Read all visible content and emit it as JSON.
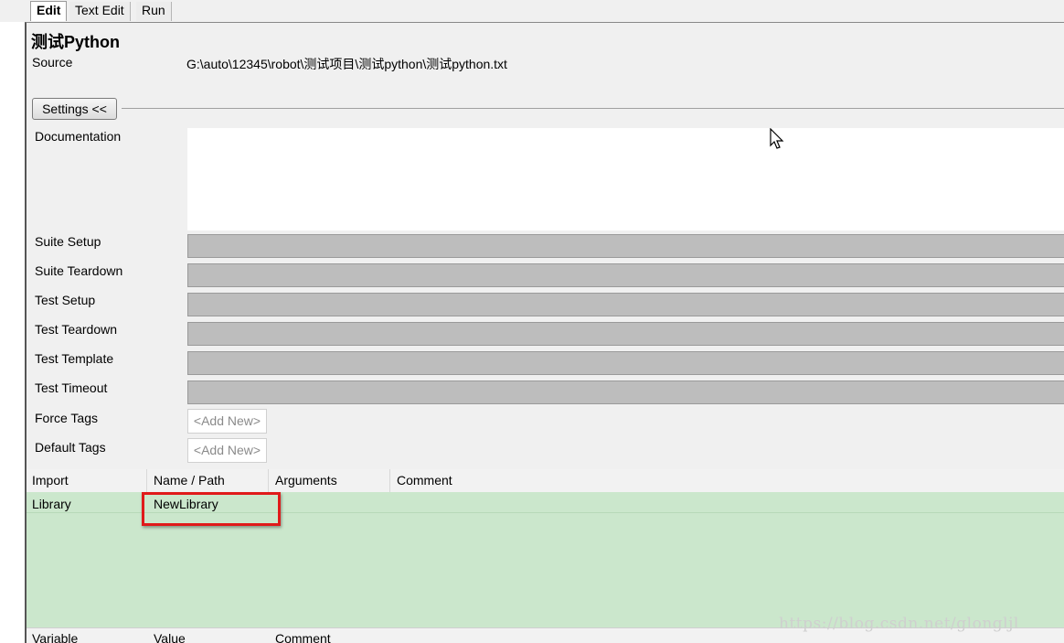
{
  "tabs": [
    {
      "label": "Edit"
    },
    {
      "label": "Text Edit"
    },
    {
      "label": "Run"
    }
  ],
  "suite": {
    "title": "测试Python",
    "source_label": "Source",
    "source_value": "G:\\auto\\12345\\robot\\测试项目\\测试python\\测试python.txt"
  },
  "settings": {
    "button_label": "Settings <<",
    "documentation_label": "Documentation",
    "fields": [
      {
        "label": "Suite Setup"
      },
      {
        "label": "Suite Teardown"
      },
      {
        "label": "Test Setup"
      },
      {
        "label": "Test Teardown"
      },
      {
        "label": "Test Template"
      },
      {
        "label": "Test Timeout"
      }
    ],
    "force_tags_label": "Force Tags",
    "default_tags_label": "Default Tags",
    "add_new_placeholder": "<Add New>"
  },
  "imports": {
    "headers": [
      "Import",
      "Name / Path",
      "Arguments",
      "Comment"
    ],
    "rows": [
      {
        "import": "Library",
        "name": "NewLibrary",
        "arguments": "",
        "comment": ""
      }
    ]
  },
  "variables": {
    "headers": [
      "Variable",
      "Value",
      "Comment"
    ]
  },
  "watermark": "https://blog.csdn.net/glongljl",
  "colors": {
    "imports_table_bg": "#cbe7cc",
    "highlight_border": "#e01a1a",
    "disabled_field": "#bdbdbd"
  }
}
